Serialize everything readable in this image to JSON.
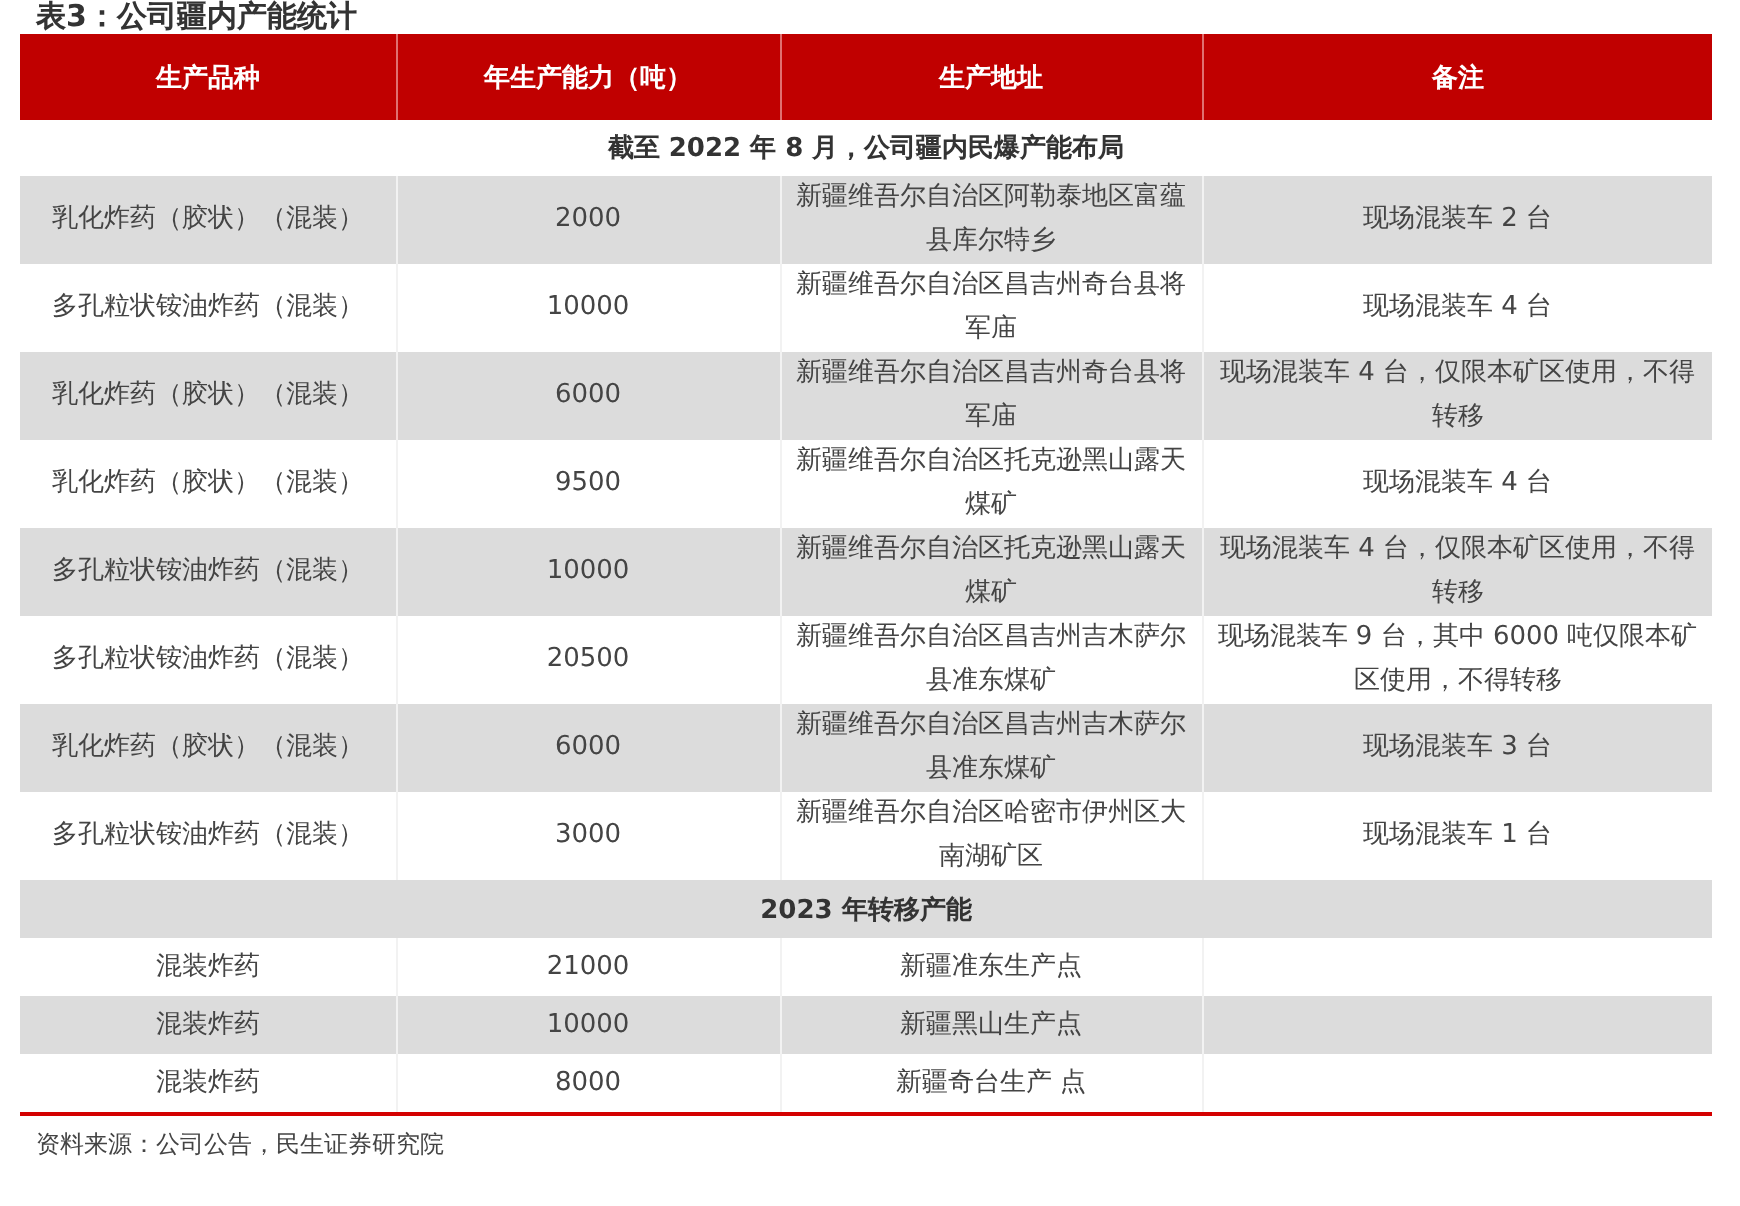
{
  "title": "表3：公司疆内产能统计",
  "table": {
    "columns": [
      "生产品种",
      "年生产能力（吨）",
      "生产地址",
      "备注"
    ],
    "sections": [
      {
        "heading": "截至 2022 年 8 月，公司疆内民爆产能布局",
        "rows": [
          [
            "乳化炸药（胶状）（混装）",
            "2000",
            "新疆维吾尔自治区阿勒泰地区富蕴县库尔特乡",
            "现场混装车 2 台"
          ],
          [
            "多孔粒状铵油炸药（混装）",
            "10000",
            "新疆维吾尔自治区昌吉州奇台县将军庙",
            "现场混装车 4 台"
          ],
          [
            "乳化炸药（胶状）（混装）",
            "6000",
            "新疆维吾尔自治区昌吉州奇台县将军庙",
            "现场混装车 4 台，仅限本矿区使用，不得转移"
          ],
          [
            "乳化炸药（胶状）（混装）",
            "9500",
            "新疆维吾尔自治区托克逊黑山露天煤矿",
            "现场混装车 4 台"
          ],
          [
            "多孔粒状铵油炸药（混装）",
            "10000",
            "新疆维吾尔自治区托克逊黑山露天煤矿",
            "现场混装车 4 台，仅限本矿区使用，不得转移"
          ],
          [
            "多孔粒状铵油炸药（混装）",
            "20500",
            "新疆维吾尔自治区昌吉州吉木萨尔县准东煤矿",
            "现场混装车 9 台，其中 6000 吨仅限本矿区使用，不得转移"
          ],
          [
            "乳化炸药（胶状）（混装）",
            "6000",
            "新疆维吾尔自治区昌吉州吉木萨尔县准东煤矿",
            "现场混装车 3 台"
          ],
          [
            "多孔粒状铵油炸药（混装）",
            "3000",
            "新疆维吾尔自治区哈密市伊州区大南湖矿区",
            "现场混装车 1 台"
          ]
        ]
      },
      {
        "heading": "2023 年转移产能",
        "rows": [
          [
            "混装炸药",
            "21000",
            "新疆准东生产点"
          ],
          [
            "混装炸药",
            "10000",
            "新疆黑山生产点"
          ],
          [
            "混装炸药",
            "8000",
            "新疆奇台生产 点"
          ]
        ]
      }
    ]
  },
  "source": "资料来源：公司公告，民生证券研究院"
}
